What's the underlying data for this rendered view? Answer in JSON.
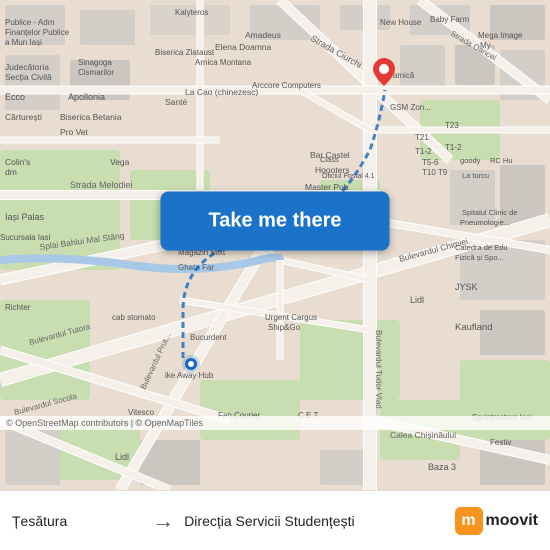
{
  "map": {
    "background_color": "#e8e0d8",
    "take_me_there_label": "Take me there",
    "copyright": "© OpenStreetMap contributors | © OpenMapTiles"
  },
  "footer": {
    "from_label": "",
    "from_place": "Țesătura",
    "arrow": "→",
    "to_label": "",
    "to_place": "Direcția Servicii Studențești",
    "moovit_text": "moovit"
  },
  "pin": {
    "color": "#e53935"
  }
}
